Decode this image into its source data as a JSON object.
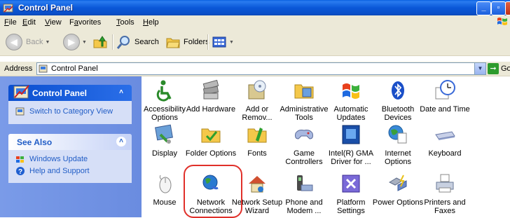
{
  "window": {
    "title": "Control Panel",
    "minimize": "_",
    "restore": "▫",
    "close": "X"
  },
  "menu": [
    {
      "label": "File",
      "accel": "F"
    },
    {
      "label": "Edit",
      "accel": "E"
    },
    {
      "label": "View",
      "accel": "V"
    },
    {
      "label": "Favorites",
      "accel": "a"
    },
    {
      "label": "Tools",
      "accel": "T"
    },
    {
      "label": "Help",
      "accel": "H"
    }
  ],
  "toolbar": {
    "back": "Back",
    "search": "Search",
    "folders": "Folders"
  },
  "address": {
    "label": "Address",
    "value": "Control Panel",
    "go": "Go"
  },
  "taskpane": {
    "control_panel": {
      "title": "Control Panel",
      "link": "Switch to Category View"
    },
    "see_also": {
      "title": "See Also",
      "links": [
        "Windows Update",
        "Help and Support"
      ]
    }
  },
  "items": [
    {
      "label": "Accessibility\nOptions",
      "icon": "accessibility-icon"
    },
    {
      "label": "Add Hardware",
      "icon": "add-hardware-icon"
    },
    {
      "label": "Add or\nRemov...",
      "icon": "add-remove-programs-icon"
    },
    {
      "label": "Administrative\nTools",
      "icon": "administrative-tools-icon"
    },
    {
      "label": "Automatic\nUpdates",
      "icon": "automatic-updates-icon"
    },
    {
      "label": "Bluetooth\nDevices",
      "icon": "bluetooth-icon"
    },
    {
      "label": "Date and Time",
      "icon": "date-time-icon"
    },
    {
      "label": "Display",
      "icon": "display-icon"
    },
    {
      "label": "Folder Options",
      "icon": "folder-options-icon"
    },
    {
      "label": "Fonts",
      "icon": "fonts-icon"
    },
    {
      "label": "Game\nControllers",
      "icon": "game-controllers-icon"
    },
    {
      "label": "Intel(R) GMA\nDriver for ...",
      "icon": "intel-gma-icon"
    },
    {
      "label": "Internet\nOptions",
      "icon": "internet-options-icon"
    },
    {
      "label": "Keyboard",
      "icon": "keyboard-icon"
    },
    {
      "label": "Mouse",
      "icon": "mouse-icon"
    },
    {
      "label": "Network\nConnections",
      "icon": "network-connections-icon"
    },
    {
      "label": "Network Setup\nWizard",
      "icon": "network-setup-wizard-icon"
    },
    {
      "label": "Phone and\nModem ...",
      "icon": "phone-modem-icon"
    },
    {
      "label": "Platform\nSettings",
      "icon": "platform-settings-icon"
    },
    {
      "label": "Power Options",
      "icon": "power-options-icon"
    },
    {
      "label": "Printers and\nFaxes",
      "icon": "printers-faxes-icon"
    }
  ],
  "colors": {
    "title_bar": "#0a58d8",
    "task_pane": "#7a9be8",
    "link": "#215dc6",
    "highlight": "#e0302a"
  }
}
